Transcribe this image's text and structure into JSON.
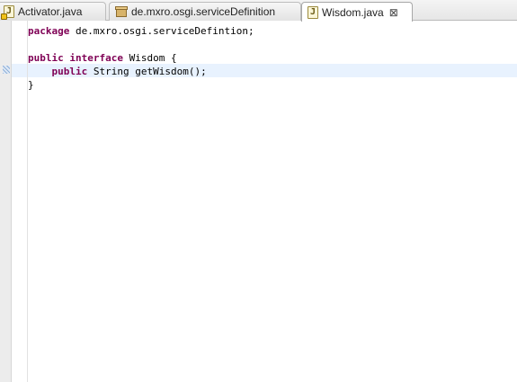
{
  "tabs": [
    {
      "label": "Activator.java",
      "icon": "java-file-warning-icon",
      "active": false
    },
    {
      "label": "de.mxro.osgi.serviceDefinition",
      "icon": "package-icon",
      "active": false
    },
    {
      "label": "Wisdom.java",
      "icon": "java-file-icon",
      "active": true,
      "close": "⊠"
    }
  ],
  "code": {
    "line1": {
      "kw": "package",
      "rest": " de.mxro.osgi.serviceDefintion;"
    },
    "line2": {
      "kw1": "public",
      "kw2": "interface",
      "rest": " Wisdom {"
    },
    "line3": {
      "indent": "    ",
      "kw": "public",
      "rest": " String getWisdom();"
    },
    "line4": {
      "text": "}"
    }
  },
  "colors": {
    "keyword": "#7f0055",
    "current_line": "#e8f2fe"
  }
}
